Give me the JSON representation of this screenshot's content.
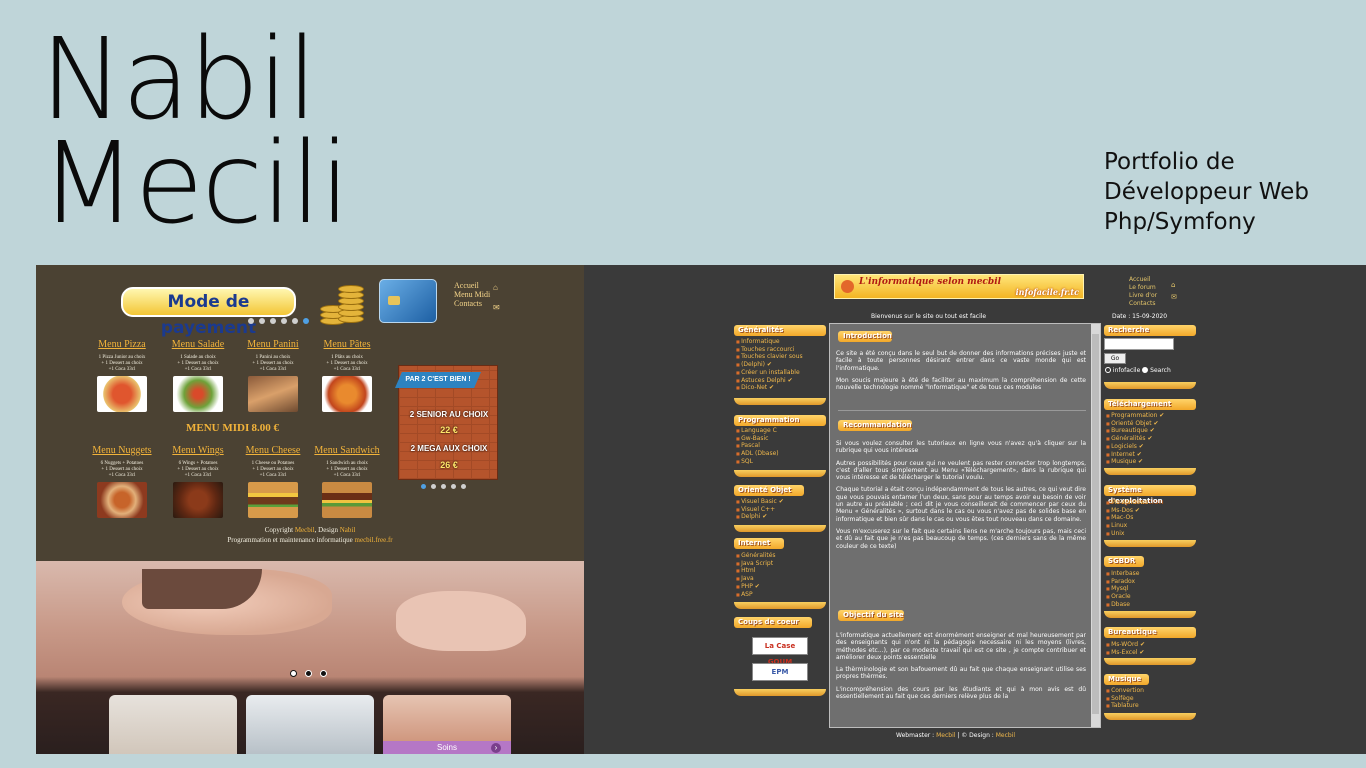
{
  "hero": {
    "name_line1": "Nabil",
    "name_line2": "Mecili",
    "subtitle_line1": "Portfolio de",
    "subtitle_line2": "Développeur Web",
    "subtitle_line3": "Php/Symfony"
  },
  "pizza_site": {
    "banner_title": "Mode de payement",
    "nav": [
      "Accueil",
      "Menu Midi",
      "Contacts"
    ],
    "menus": [
      {
        "title": "Menu Pizza",
        "desc": "1 Pizza Junior au choix\n+ 1 Dessert au choix\n+1 Coca 33cl"
      },
      {
        "title": "Menu Salade",
        "desc": "1 Salade au choix\n+ 1 Dessert au choix\n+1 Coca 33cl"
      },
      {
        "title": "Menu Panini",
        "desc": "1 Panini au choix\n+ 1 Dessert au choix\n+1 Coca 33cl"
      },
      {
        "title": "Menu Pâtes",
        "desc": "1 Plâts au choix\n+ 1 Dessert au choix\n+1 Coca 33cl"
      },
      {
        "title": "Menu Nuggets",
        "desc": "6 Nuggets + Potatoes\n+ 1 Dessert au choix\n+1 Coca 33cl"
      },
      {
        "title": "Menu Wings",
        "desc": "6 Wings + Potatoes\n+ 1 Dessert au choix\n+1 Coca 33cl"
      },
      {
        "title": "Menu Cheese",
        "desc": "1 Cheese ou Potatoes\n+ 1 Dessert au choix\n+1 Coca 33cl"
      },
      {
        "title": "Menu Sandwich",
        "desc": "1 Sandwich au choix\n+ 1 Dessert au choix\n+1 Coca 33cl"
      }
    ],
    "menu_midi_label": "MENU MIDI",
    "menu_midi_price": "8.00 €",
    "promo": {
      "head": "PAR 2 C'EST BIEN !",
      "line1": "2 SENIOR AU CHOIX",
      "price1": "22 €",
      "line2": "2 MEGA AUX CHOIX",
      "price2": "26 €"
    },
    "copyright_prefix": "Copyright",
    "copyright_name": "Mecbil",
    "copyright_mid": ", Design",
    "copyright_design": "Nabil",
    "maintenance_text": "Programmation et maintenance informatique",
    "maintenance_link": "mecbil.free.fr"
  },
  "spa_site": {
    "soins_label": "Soins",
    "arrow": "›"
  },
  "infofacile_site": {
    "logo_text": "L'informatique selon mecbil",
    "logo_domain": "infofacile.fr.tc",
    "nav": [
      "Accueil",
      "Le forum",
      "Livre d'or",
      "Contacts"
    ],
    "welcome": "Bienvenus sur le site ou tout est facile",
    "date": "Date : 15-09-2020",
    "left_sections": [
      {
        "title": "Généralités",
        "items": [
          "Informatique",
          "Touches raccourci",
          "Touches clavier sous",
          "(Delphi) ✔",
          "Créer un installable",
          "Astuces Delphi ✔",
          "Dico-Net ✔"
        ]
      },
      {
        "title": "Programmation",
        "items": [
          "Language C",
          "Gw-Basic",
          "Pascal",
          "ADL (Dbase)",
          "SQL"
        ]
      },
      {
        "title": "Orienté Objet",
        "items": [
          "Visuel Basic ✔",
          "Visuel C++",
          "Delphi ✔"
        ]
      },
      {
        "title": "Internet",
        "items": [
          "Généralités",
          "Java Script",
          "Html",
          "Java",
          "PHP ✔",
          "ASP"
        ]
      },
      {
        "title": "Coups de coeur",
        "items": []
      }
    ],
    "badges": [
      "La Case GOUM",
      "EPM"
    ],
    "right_sections": [
      {
        "title": "Recherche",
        "items": []
      },
      {
        "title": "Téléchargement",
        "items": [
          "Programmation ✔",
          "Orienté Objet ✔",
          "Bureautique ✔",
          "Généralités ✔",
          "Logiciels ✔",
          "Internet ✔",
          "Musique ✔"
        ]
      },
      {
        "title": "Système d'exploitation",
        "items": [
          "Ms-Windows",
          "Ms-Dos ✔",
          "Mac-Os",
          "Linux",
          "Unix"
        ]
      },
      {
        "title": "SGBDR",
        "items": [
          "Interbase",
          "Paradox",
          "Mysql",
          "Oracle",
          "Dbase"
        ]
      },
      {
        "title": "Bureautique",
        "items": [
          "Ms-WOrd ✔",
          "Ms-Excel ✔"
        ]
      },
      {
        "title": "Musique",
        "items": [
          "Convertion",
          "Solfège",
          "Tablature"
        ]
      }
    ],
    "search": {
      "go_label": "Go",
      "option1": "infofacile",
      "option2": "Search"
    },
    "main": {
      "intro_title": "Introduction",
      "intro_p1": "Ce site a été conçu dans le seul but de donner des informations précises juste et facile à toute personnes désirant entrer dans ce vaste monde qui est l'informatique.",
      "intro_p2": "Mon soucis majeure à été de faciliter au maximum la compréhension de cette nouvelle technologie nommé \"Informatique\" et de tous ces modules",
      "reco_title": "Recommandation",
      "reco_p1": "Si vous voulez consulter les tutoriaux en ligne vous n'avez qu'à cliquer sur la rubrique qui vous intéresse",
      "reco_p2": "Autres possibilités pour ceux qui ne veulent pas rester connecter trop longtemps, c'est d'aller tous simplement au Menu «Téléchargement», dans la rubrique qui vous intéresse et de télécharger le tutorial voulu.",
      "reco_p3": "Chaque tutorial a était conçu indépendamment de tous les autres, ce qui veut dire que vous pouvais entamer l'un deux, sans pour au temps avoir eu besoin de voir un autre au préalable ; ceci dit je vous conseillerait de commencer par ceux du Menu « Généralités », surtout dans le cas ou vous n'avez pas de solides base en informatique et bien sûr dans le cas ou vous êtes tout nouveau dans ce domaine.",
      "reco_p4": "Vous m'excuserez sur le fait que certains liens ne m'arche toujours pas, mais ceci et dû au fait que je n'es pas beaucoup de temps. (ces derniers sans de la même couleur de ce texte)",
      "obj_title": "Objectif du site",
      "obj_p1": "L'informatique actuellement est énormément enseigner et mal heureusement par des enseignants qui n'ont ni la pédagogie necessaire ni les moyens (livres, méthodes etc...), par ce modeste travail qui est ce site , je compte contribuer et améliorer deux points essentielle",
      "obj_p2": "La thèrminologie et son bafouement dû au fait que chaque enseignant utilise ses propres thèrmes.",
      "obj_p3": "L'incompréhension des cours par les étudiants et qui à mon avis est dû essentiellement au fait que ces derniers relève plus de la"
    },
    "footer_prefix": "Webmaster :",
    "footer_webmaster": "Mecbil",
    "footer_mid": "| © Design :",
    "footer_design": "Mecbil"
  }
}
